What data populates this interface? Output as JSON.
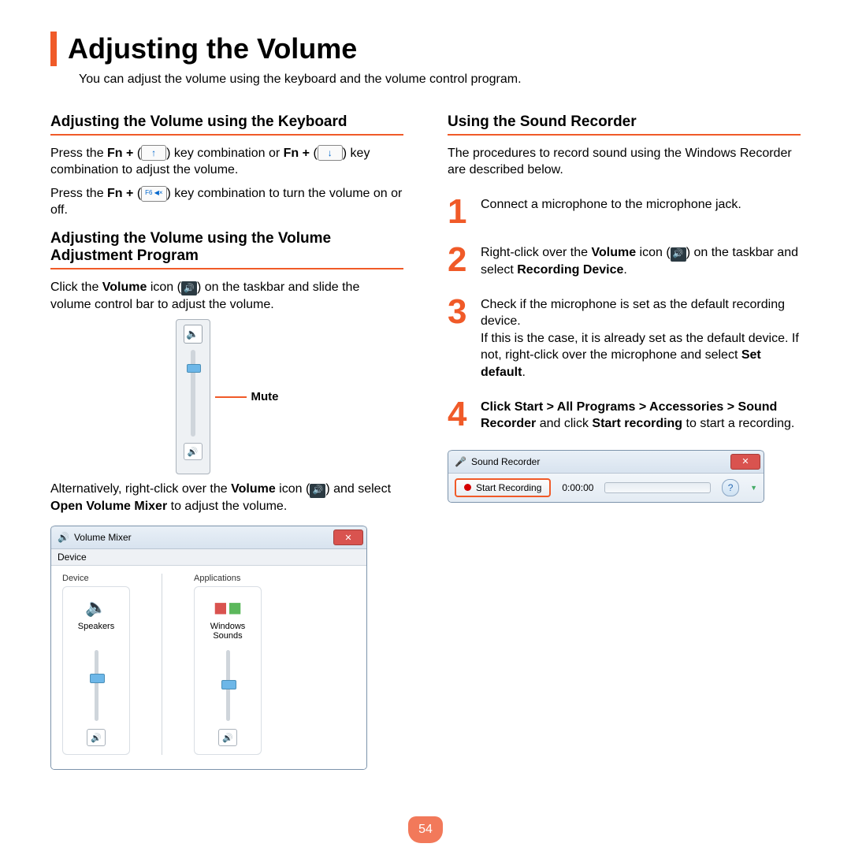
{
  "title": "Adjusting the Volume",
  "intro": "You can adjust the volume using the keyboard and the volume control program.",
  "left": {
    "h1": "Adjusting the Volume using the Keyboard",
    "p1a": "Press the ",
    "p1b": "Fn + ",
    "p1c": ") key combination or ",
    "p1d": "Fn + ",
    "p1e": ") key combination to adjust the volume.",
    "p2a": "Press the ",
    "p2b": "Fn + ",
    "p2c": ") key combination to turn the volume on or off.",
    "fn_up": "↑",
    "fn_down": "↓",
    "fn_mute": "F6 ◀×",
    "h2": "Adjusting the Volume using the Volume Adjustment Program",
    "p3a": "Click the ",
    "p3b": "Volume",
    "p3c": " icon (",
    "p3d": ") on the taskbar and slide the volume control bar to adjust the volume.",
    "mute_label": "Mute",
    "p4a": "Alternatively, right-click over the ",
    "p4b": "Volume",
    "p4c": " icon (",
    "p4d": ") and select ",
    "p4e": "Open Volume Mixer",
    "p4f": " to adjust the volume.",
    "mixer": {
      "title": "Volume Mixer",
      "menu": "Device",
      "group_device": "Device",
      "group_apps": "Applications",
      "item1": "Speakers",
      "item2": "Windows Sounds"
    }
  },
  "right": {
    "h1": "Using the Sound Recorder",
    "p1": "The procedures to record sound using the Windows Recorder are described below.",
    "steps": {
      "s1": "Connect a microphone to the microphone jack.",
      "s2a": "Right-click over the ",
      "s2b": "Volume",
      "s2c": " icon (",
      "s2d": ") on the taskbar and select ",
      "s2e": "Recording Device",
      "s2f": ".",
      "s3a": "Check if the microphone is set as the default recording device.",
      "s3b": "If this is the case, it is already set as the default device. If not, right-click over the microphone and select ",
      "s3c": "Set default",
      "s3d": ".",
      "s4a": "Click Start > All Programs > Accessories > Sound Recorder",
      "s4b": " and click ",
      "s4c": "Start recording",
      "s4d": " to start a recording."
    },
    "rec": {
      "title": "Sound Recorder",
      "btn": "Start Recording",
      "time": "0:00:00"
    }
  },
  "page_num": "54"
}
